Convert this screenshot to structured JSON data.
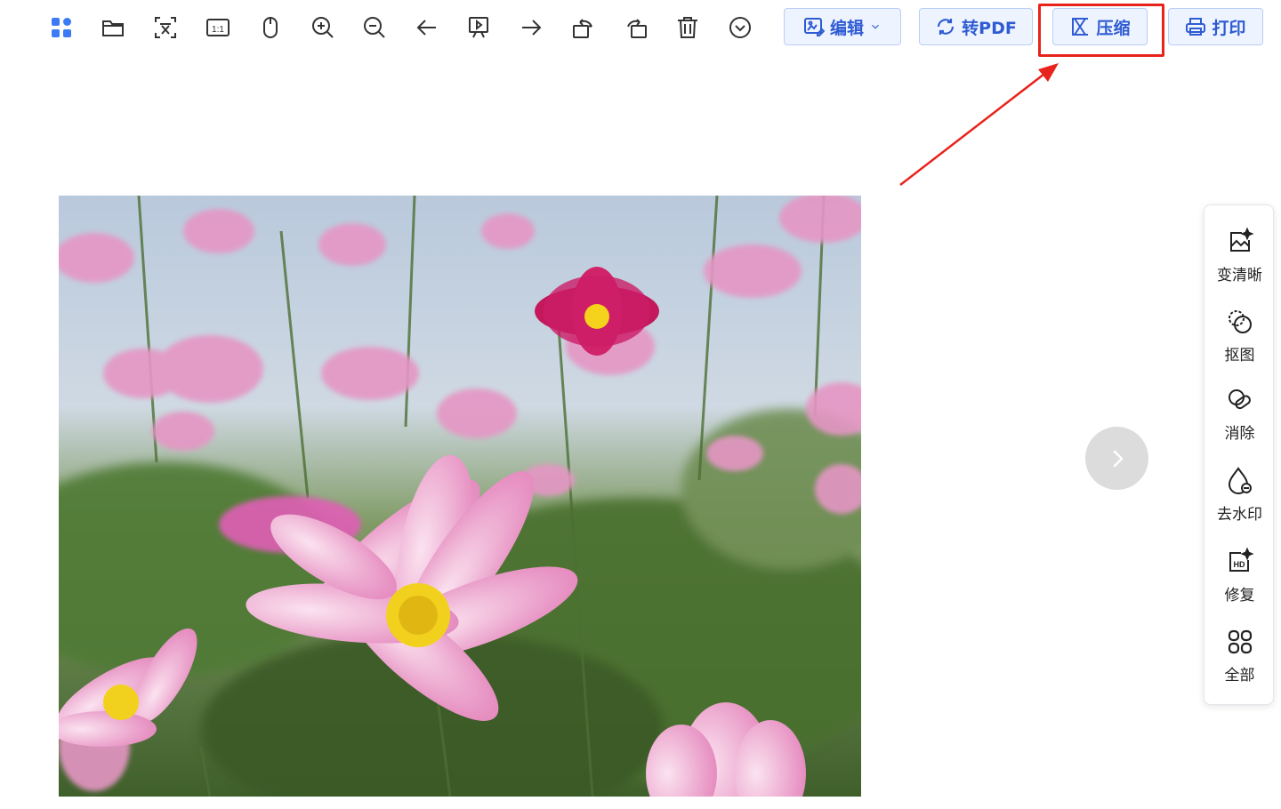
{
  "toolbar": {
    "icons": [
      "apps-icon",
      "folder-icon",
      "ocr-text-icon",
      "actual-size-icon",
      "mouse-icon",
      "zoom-in-icon",
      "zoom-out-icon",
      "previous-icon",
      "slideshow-icon",
      "next-icon",
      "rotate-left-icon",
      "rotate-right-icon",
      "delete-icon",
      "more-icon"
    ],
    "edit_label": "编辑",
    "to_pdf_label": "转PDF",
    "compress_label": "压缩",
    "print_label": "打印",
    "accent_color": "#2f5bd3",
    "highlight_color": "#e8231b"
  },
  "side_panel": {
    "items": [
      {
        "icon": "enhance-icon",
        "label": "变清晰"
      },
      {
        "icon": "cutout-icon",
        "label": "抠图"
      },
      {
        "icon": "erase-icon",
        "label": "消除"
      },
      {
        "icon": "remove-watermark-icon",
        "label": "去水印"
      },
      {
        "icon": "hd-repair-icon",
        "label": "修复"
      },
      {
        "icon": "all-tools-icon",
        "label": "全部"
      }
    ]
  },
  "viewer": {
    "image_subject": "cosmos-flowers-photo"
  }
}
